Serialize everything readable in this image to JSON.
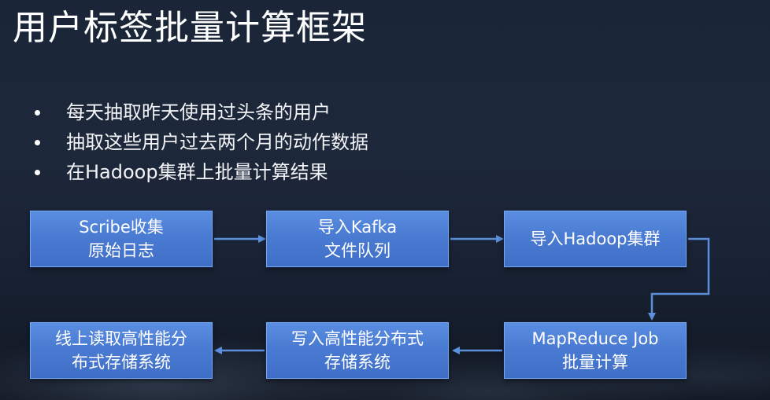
{
  "slide": {
    "title": "用户标签批量计算框架",
    "bullets": [
      "每天抽取昨天使用过头条的用户",
      "抽取这些用户过去两个月的动作数据",
      "在Hadoop集群上批量计算结果"
    ]
  },
  "flow": {
    "nodes": [
      {
        "lines": [
          "Scribe收集",
          "原始日志"
        ]
      },
      {
        "lines": [
          "导入Kafka",
          "文件队列"
        ]
      },
      {
        "lines": [
          "导入Hadoop集群"
        ]
      },
      {
        "lines": [
          "MapReduce Job",
          "批量计算"
        ]
      },
      {
        "lines": [
          "写入高性能分布式",
          "存储系统"
        ]
      },
      {
        "lines": [
          "线上读取高性能分",
          "布式存储系统"
        ]
      }
    ]
  },
  "colors": {
    "node_fill": "#4a7bd2",
    "node_border": "#7aa6ec",
    "arrow": "#5b8fdc"
  }
}
